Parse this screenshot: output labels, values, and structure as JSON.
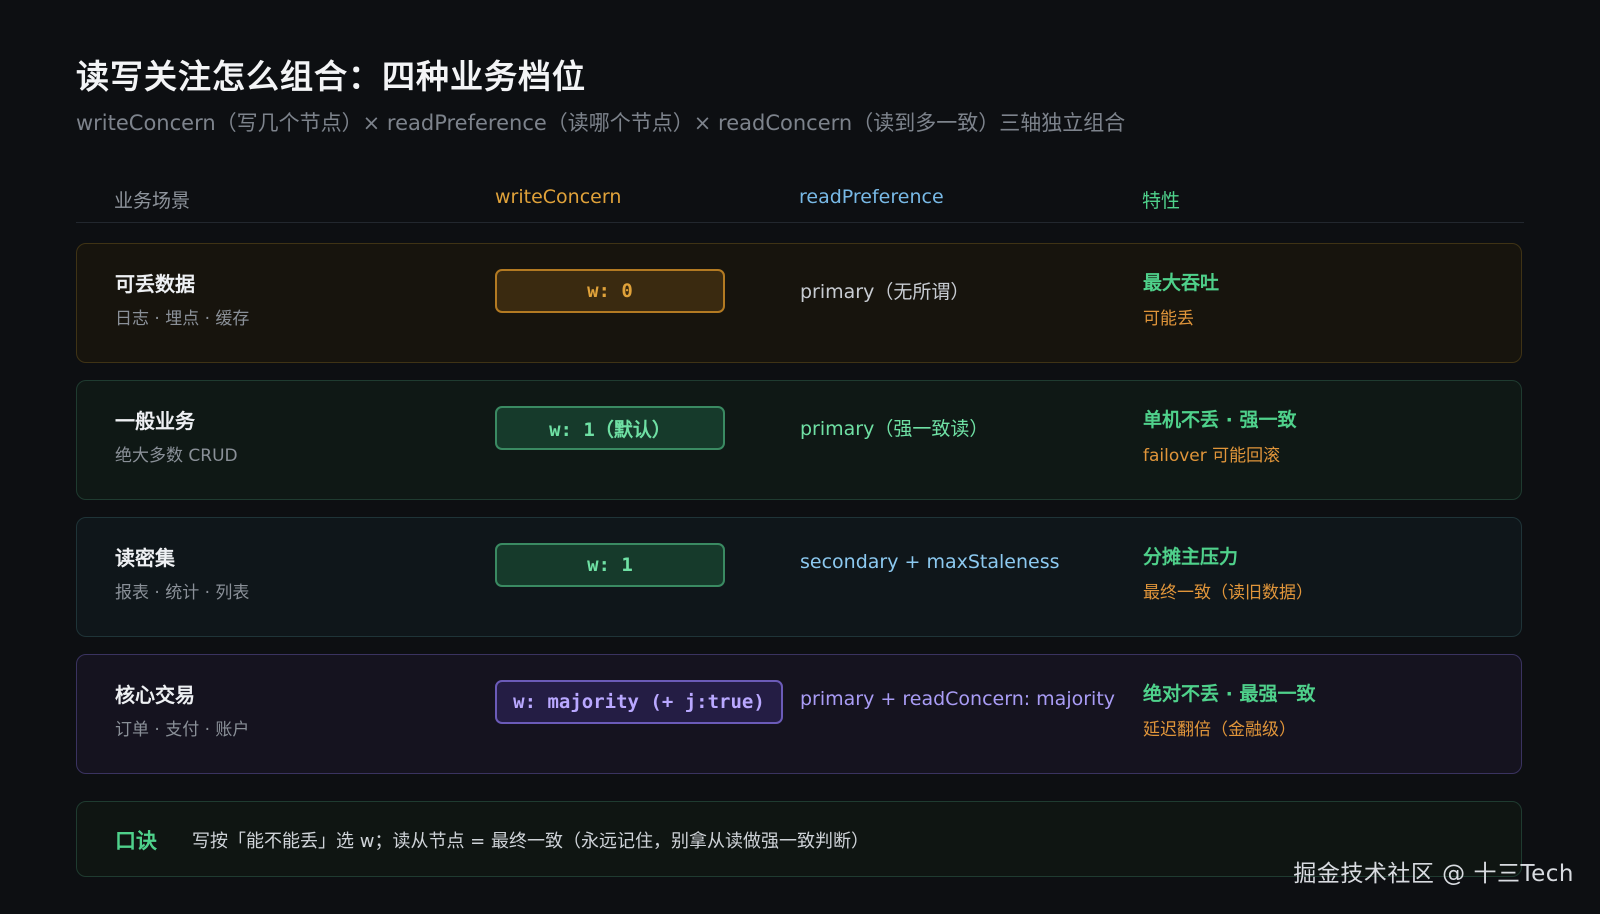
{
  "title": "读写关注怎么组合：四种业务档位",
  "subtitle": "writeConcern（写几个节点）× readPreference（读哪个节点）× readConcern（读到多一致）三轴独立组合",
  "columns": {
    "scene": "业务场景",
    "write": "writeConcern",
    "read": "readPreference",
    "prop": "特性"
  },
  "rows": [
    {
      "title": "可丢数据",
      "subtitle": "日志 · 埋点 · 缓存",
      "write": "w: 0",
      "read": "primary（无所谓）",
      "prop_main": "最大吞吐",
      "prop_sub": "可能丢"
    },
    {
      "title": "一般业务",
      "subtitle": "绝大多数 CRUD",
      "write": "w: 1（默认）",
      "read": "primary（强一致读）",
      "prop_main": "单机不丢 · 强一致",
      "prop_sub": "failover 可能回滚"
    },
    {
      "title": "读密集",
      "subtitle": "报表 · 统计 · 列表",
      "write": "w: 1",
      "read": "secondary + maxStaleness",
      "prop_main": "分摊主压力",
      "prop_sub": "最终一致（读旧数据）"
    },
    {
      "title": "核心交易",
      "subtitle": "订单 · 支付 · 账户",
      "write": "w: majority (+ j:true)",
      "read": "primary + readConcern: majority",
      "prop_main": "绝对不丢 · 最强一致",
      "prop_sub": "延迟翻倍（金融级）"
    }
  ],
  "footer": {
    "label": "口诀",
    "text": "写按「能不能丢」选 w；读从节点 = 最终一致（永远记住，别拿从读做强一致判断）"
  },
  "watermark": "掘金技术社区 @ 十三Tech",
  "colors": {
    "background": "#0d0f12",
    "accent_orange": "#e0a23a",
    "accent_green": "#4fd18b",
    "accent_blue": "#78b9e6",
    "accent_purple": "#b9a8ff"
  }
}
